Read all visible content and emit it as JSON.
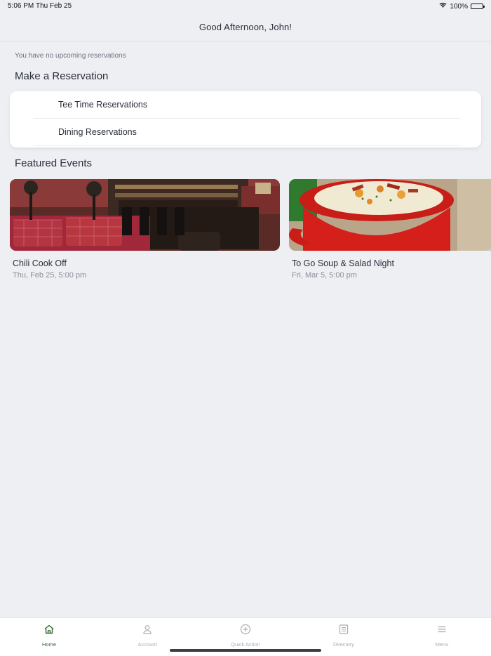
{
  "status_bar": {
    "time": "5:06 PM",
    "date": "Thu Feb 25",
    "battery": "100%",
    "icons": [
      "wifi-icon",
      "battery-icon"
    ]
  },
  "header": {
    "title": "Good Afternoon, John!"
  },
  "reservations": {
    "empty_message": "You have no upcoming reservations",
    "title": "Make a Reservation",
    "options": [
      {
        "label": "Tee Time Reservations"
      },
      {
        "label": "Dining Reservations"
      }
    ]
  },
  "events": {
    "title": "Featured Events",
    "items": [
      {
        "name": "Chili Cook Off",
        "date": "Thu, Feb 25, 5:00 pm",
        "image": "club-lounge-photo"
      },
      {
        "name": "To Go Soup & Salad Night",
        "date": "Fri, Mar 5, 5:00 pm",
        "image": "soup-bowl-photo"
      }
    ]
  },
  "tab_bar": {
    "active": "Home",
    "colors": {
      "active": "#2f6a2f",
      "inactive": "#a8acb4"
    },
    "tabs": [
      {
        "label": "Home",
        "icon": "home-icon"
      },
      {
        "label": "Account",
        "icon": "person-icon"
      },
      {
        "label": "Quick Action",
        "icon": "plus-circle-icon"
      },
      {
        "label": "Directory",
        "icon": "book-icon"
      },
      {
        "label": "Menu",
        "icon": "hamburger-icon"
      }
    ]
  }
}
